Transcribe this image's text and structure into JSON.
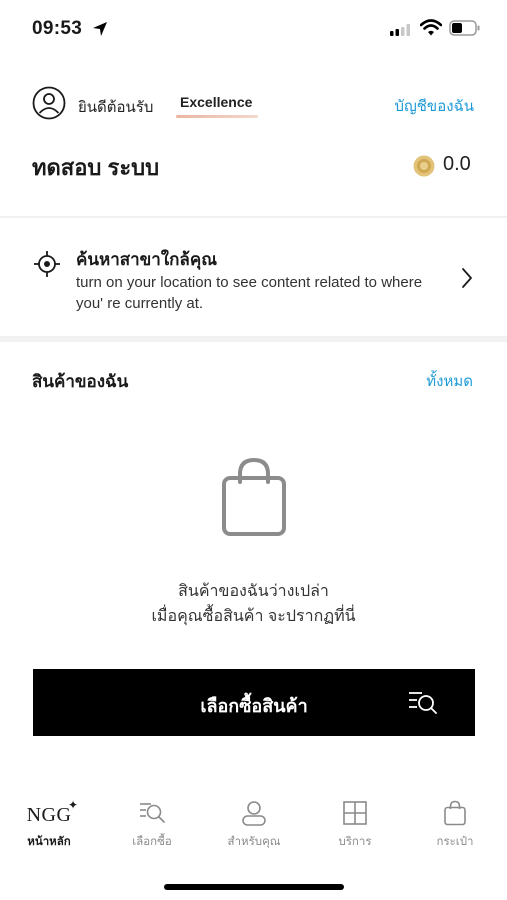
{
  "status_bar": {
    "time": "09:53",
    "icons": [
      "location-arrow-icon",
      "signal-icon",
      "wifi-icon",
      "battery-icon"
    ]
  },
  "header": {
    "welcome": "ยินดีต้อนรับ",
    "tier": "Excellence",
    "account_link": "บัญชีของฉัน",
    "user_name": "ทดสอบ ระบบ",
    "points": "0.0"
  },
  "location": {
    "title": "ค้นหาสาขาใกล้คุณ",
    "description": "turn on your location to see content related to where you' re currently at."
  },
  "products": {
    "title": "สินค้าของฉัน",
    "view_all": "ทั้งหมด",
    "empty_line1": "สินค้าของฉันว่างเปล่า",
    "empty_line2": "เมื่อคุณซื้อสินค้า จะปรากฏที่นี่",
    "shop_button": "เลือกซื้อสินค้า"
  },
  "bottom_nav": {
    "logo": "NGG",
    "items": [
      {
        "label": "หน้าหลัก",
        "icon": "ngg-logo-icon",
        "active": true
      },
      {
        "label": "เลือกซื้อ",
        "icon": "search-list-icon",
        "active": false
      },
      {
        "label": "สำหรับคุณ",
        "icon": "person-icon",
        "active": false
      },
      {
        "label": "บริการ",
        "icon": "grid-icon",
        "active": false
      },
      {
        "label": "กระเป๋า",
        "icon": "bag-icon",
        "active": false
      }
    ]
  },
  "colors": {
    "link": "#1e9ad6",
    "button_bg": "#000000",
    "tier_underline": "#e9b6a1",
    "coin": "#d8b46a"
  }
}
